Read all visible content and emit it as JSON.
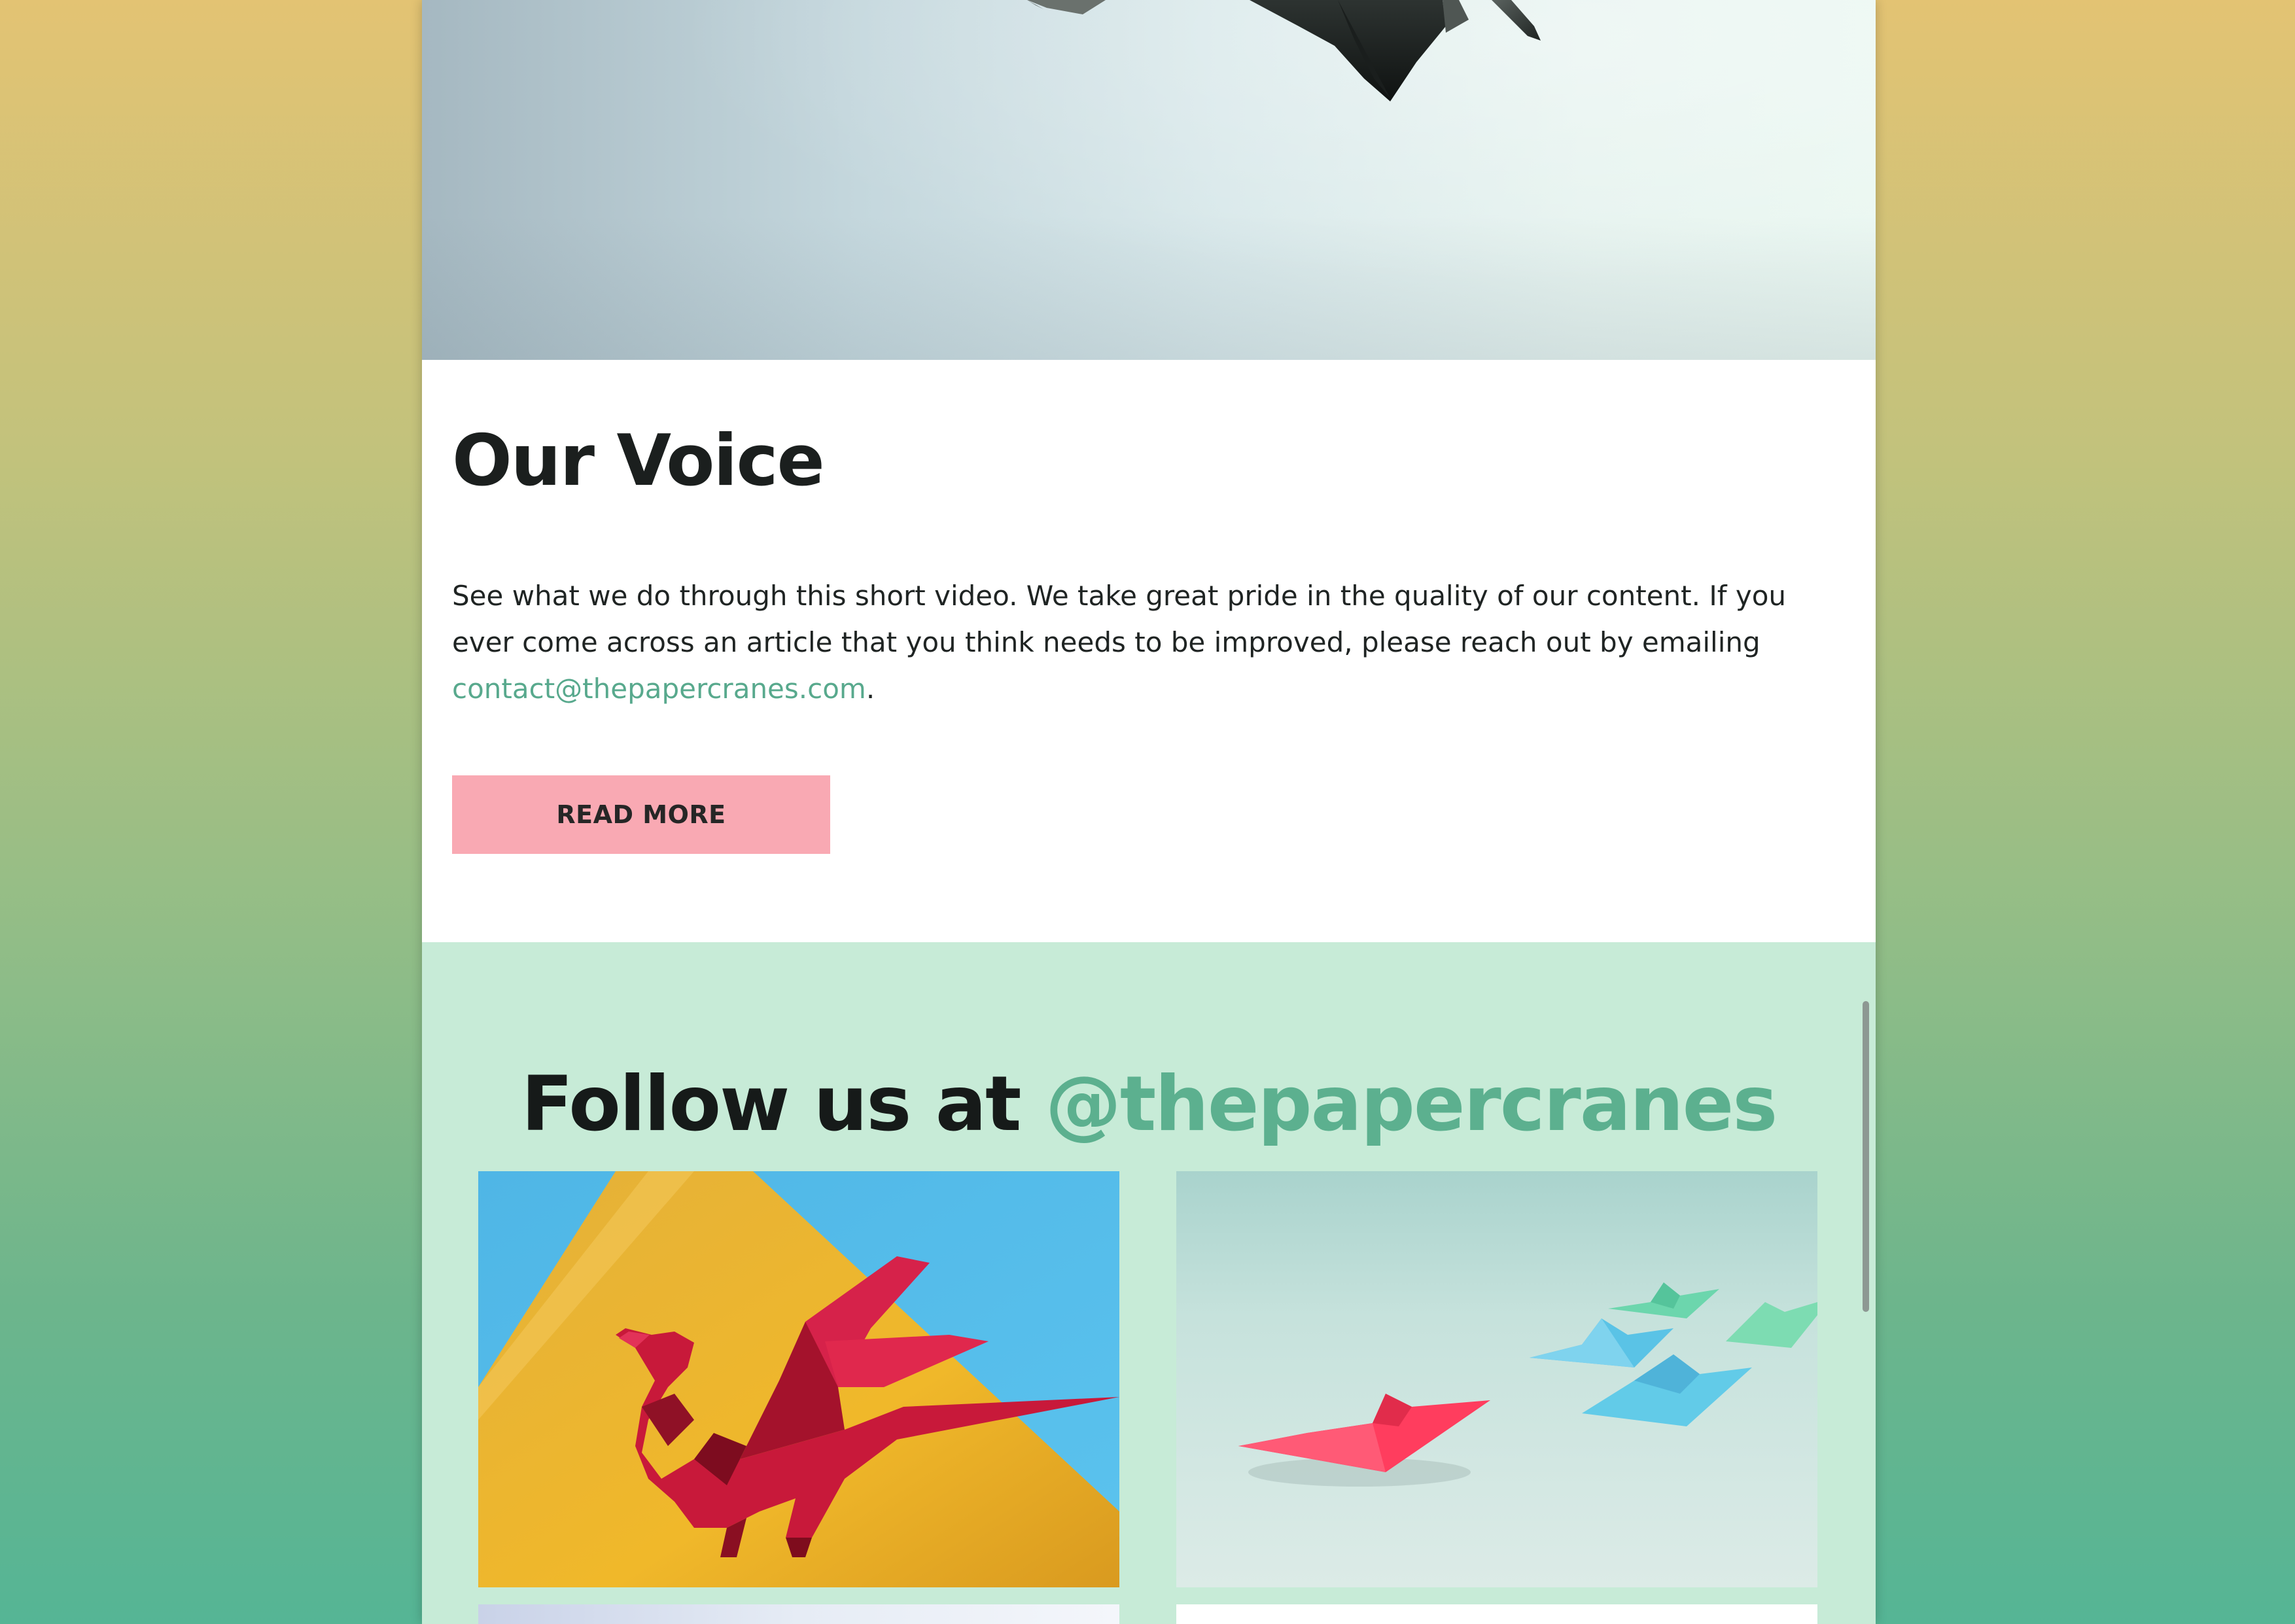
{
  "hero": {
    "image": "origami-crane-photo"
  },
  "voice": {
    "title": "Our Voice",
    "body_text": "See what we do through this short video. We take great pride in the quality of our content. If you ever come across an article that you think needs to be improved, please reach out by emailing ",
    "email_link": "contact@thepapercranes.com",
    "body_end": ".",
    "button_label": "READ MORE",
    "button_color": "#f9a9b3",
    "link_color": "#58a98d"
  },
  "follow": {
    "title_prefix": "Follow us at ",
    "handle": "@thepapercranes",
    "background_color": "#c7ebd7",
    "images": [
      {
        "subject": "red-origami-dragon-on-yellow"
      },
      {
        "subject": "pink-and-blue-paper-boats"
      },
      {
        "subject": "partial-image"
      },
      {
        "subject": "partial-image"
      }
    ]
  }
}
